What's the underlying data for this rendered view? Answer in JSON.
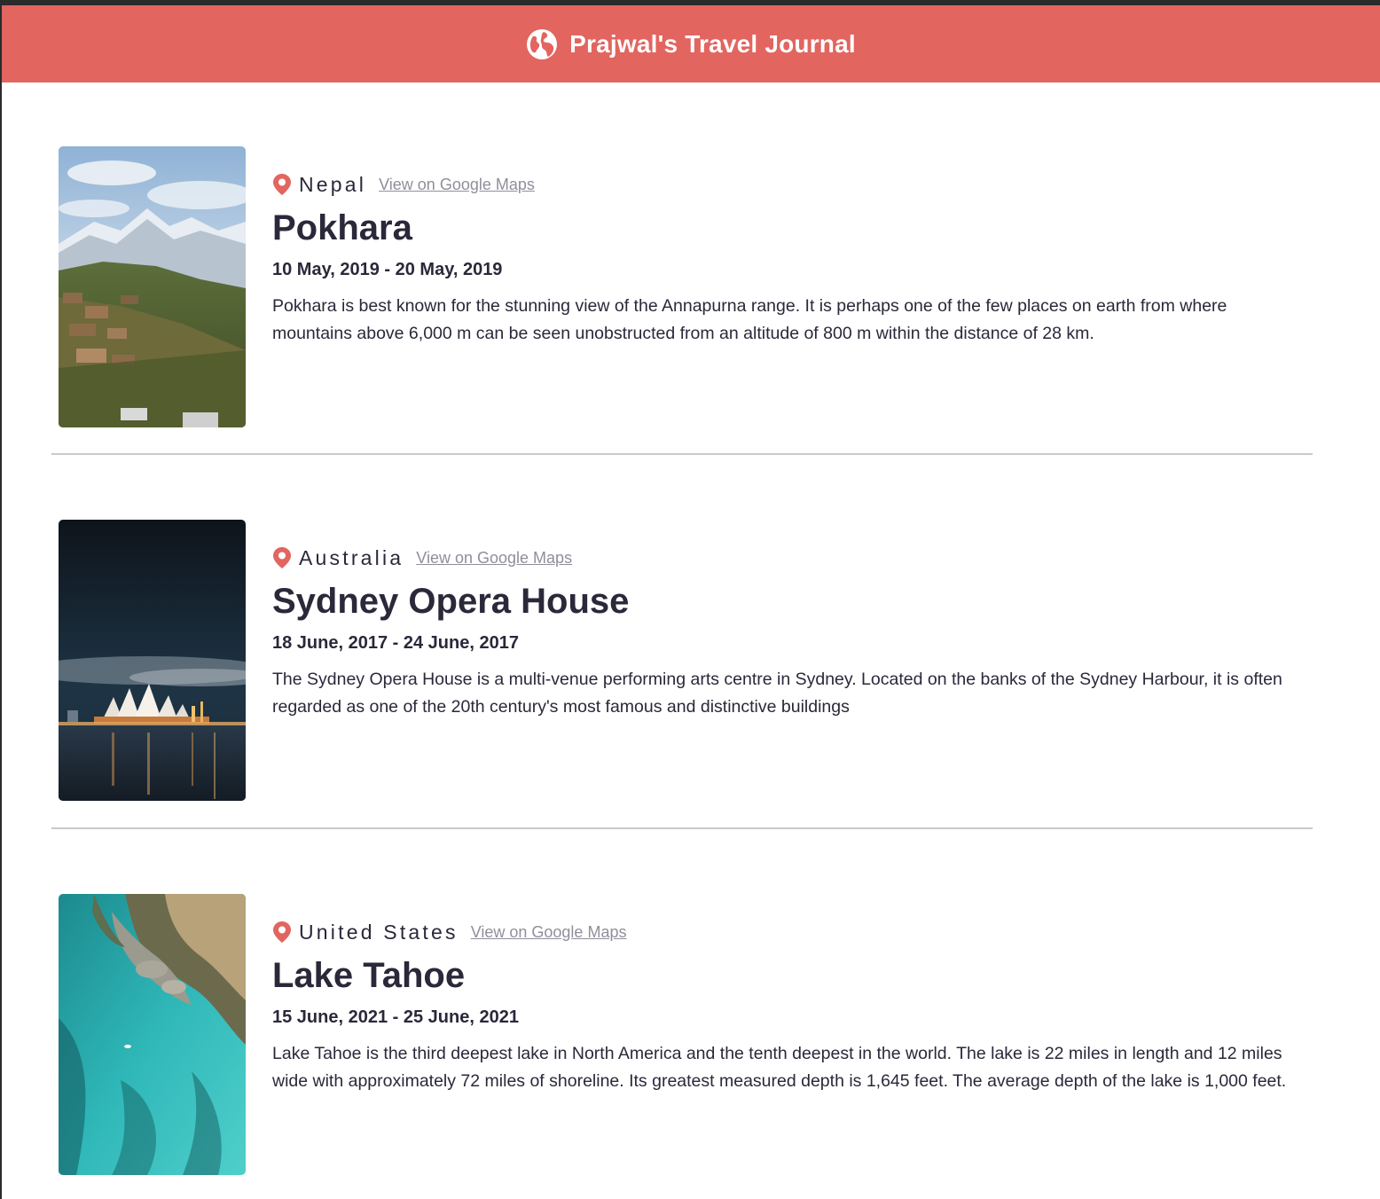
{
  "header": {
    "title": "Prajwal's Travel Journal",
    "icon": "globe-icon",
    "background": "#E26560"
  },
  "entries": [
    {
      "country": "Nepal",
      "map_link": "View on Google Maps",
      "place": "Pokhara",
      "dates": "10 May, 2019 - 20 May, 2019",
      "description": "Pokhara is best known for the stunning view of the Annapurna range. It is perhaps one of the few places on earth from where mountains above 6,000 m can be seen unobstructed from an altitude of 800 m within the distance of 28 km."
    },
    {
      "country": "Australia",
      "map_link": "View on Google Maps",
      "place": "Sydney Opera House",
      "dates": "18 June, 2017 - 24 June, 2017",
      "description": "The Sydney Opera House is a multi-venue performing arts centre in Sydney. Located on the banks of the Sydney Harbour, it is often regarded as one of the 20th century's most famous and distinctive buildings"
    },
    {
      "country": "United States",
      "map_link": "View on Google Maps",
      "place": "Lake Tahoe",
      "dates": "15 June, 2021 - 25 June, 2021",
      "description": "Lake Tahoe is the third deepest lake in North America and the tenth deepest in the world. The lake is 22 miles in length and 12 miles wide with approximately 72 miles of shoreline. Its greatest measured depth is 1,645 feet. The average depth of the lake is 1,000 feet."
    }
  ],
  "colors": {
    "accent": "#E26560",
    "text": "#2B283A",
    "link": "#918E9B",
    "divider": "#C9C9C9"
  }
}
